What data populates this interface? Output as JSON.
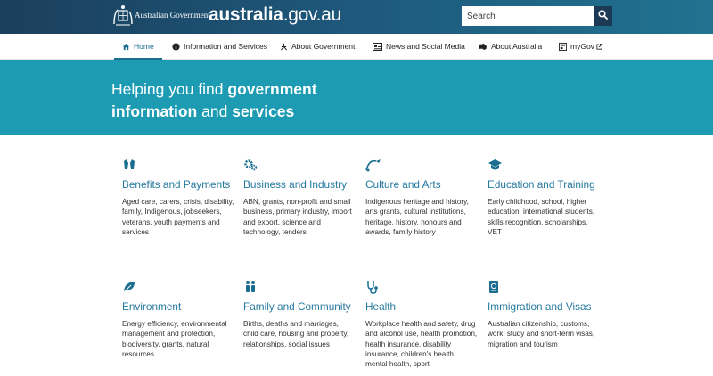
{
  "header": {
    "gov_label": "Australian Government",
    "logo_bold": "australia",
    "logo_rest": ".gov.au",
    "search_placeholder": "Search",
    "icons": {
      "crest": "coat-of-arms-icon",
      "search": "search-icon"
    }
  },
  "nav": {
    "items": [
      {
        "label": "Home",
        "icon": "home-icon"
      },
      {
        "label": "Information and Services",
        "icon": "info-icon"
      },
      {
        "label": "About Government",
        "icon": "government-icon"
      },
      {
        "label": "News and Social Media",
        "icon": "news-icon"
      },
      {
        "label": "About Australia",
        "icon": "australia-map-icon"
      },
      {
        "label": "myGov",
        "icon": "mygov-icon"
      }
    ]
  },
  "banner": {
    "part1": "Helping you find",
    "part2": "government",
    "part3": "information",
    "part4": "and",
    "part5": "services"
  },
  "categories": [
    {
      "title": "Benefits and Payments",
      "description": "Aged care, carers, crisis, disability, family, Indigenous, jobseekers, veterans, youth payments and services",
      "icon": "benefits-hands-icon"
    },
    {
      "title": "Business and Industry",
      "description": "ABN, grants, non-profit and small business, primary industry, import and export, science and technology, tenders",
      "icon": "business-gears-icon"
    },
    {
      "title": "Culture and Arts",
      "description": "Indigenous heritage and history, arts grants, cultural institutions, heritage, history, honours and awards, family history",
      "icon": "culture-arts-icon"
    },
    {
      "title": "Education and Training",
      "description": "Early childhood, school, higher education, international students, skills recognition, scholarships, VET",
      "icon": "graduation-cap-icon"
    },
    {
      "title": "Environment",
      "description": "Energy efficiency, environmental management and protection, biodiversity, grants, natural resources",
      "icon": "leaf-icon"
    },
    {
      "title": "Family and Community",
      "description": "Births, deaths and marriages, child care, housing and property, relationships, social issues",
      "icon": "family-icon"
    },
    {
      "title": "Health",
      "description": "Workplace health and safety, drug and alcohol use, health promotion, health insurance, disability insurance, children's health, mental health, sport",
      "icon": "stethoscope-icon"
    },
    {
      "title": "Immigration and Visas",
      "description": "Australian citizenship, customs, work, study and short-term visas, migration and tourism",
      "icon": "passport-icon"
    }
  ],
  "colors": {
    "header_start": "#1b3f5c",
    "header_end": "#217290",
    "banner": "#1c9bb3",
    "link": "#2579a0",
    "accent_icon": "#1a6e8f"
  }
}
